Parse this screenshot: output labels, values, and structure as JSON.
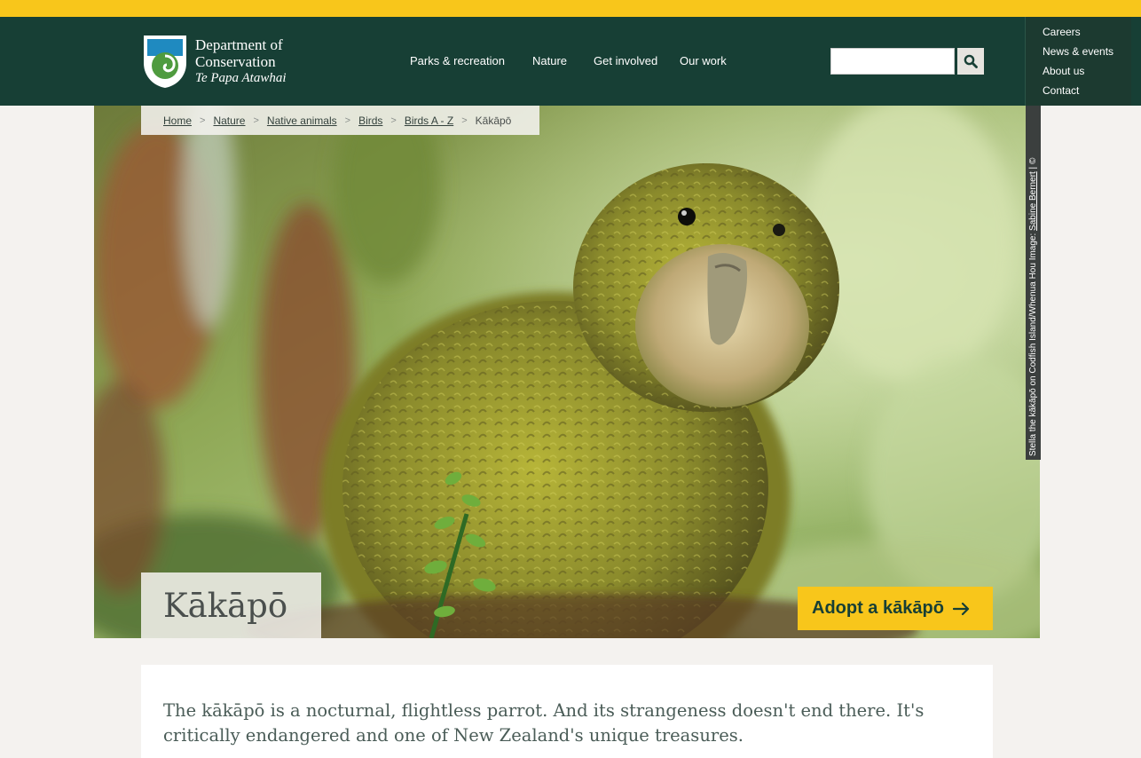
{
  "colors": {
    "brand_yellow": "#f8c61b",
    "header_green": "#173f35",
    "page_background": "#f4f2ef",
    "text_grey": "#4a4f4d"
  },
  "logo": {
    "line1": "Department of",
    "line2": "Conservation",
    "line3": "Te Papa Atawhai",
    "icon": "doc-shield-logo-icon"
  },
  "main_nav": [
    "Parks & recreation",
    "Nature",
    "Get involved",
    "Our work"
  ],
  "search": {
    "value": "",
    "icon": "search-icon"
  },
  "utility_nav": [
    "Careers",
    "News & events",
    "About us",
    "Contact"
  ],
  "breadcrumb": {
    "items": [
      "Home",
      "Nature",
      "Native animals",
      "Birds",
      "Birds A - Z"
    ],
    "current": "Kākāpō",
    "separator": ">"
  },
  "photo_credit": {
    "caption": "Stella the kākāpō on Codfish Island/Whenua Hou",
    "image_label": "Image:",
    "photographer": "Sabine Bernert",
    "separator": "|",
    "copyright": "©"
  },
  "page_title": "Kākāpō",
  "adopt_button": {
    "label": "Adopt a kākāpō",
    "icon": "arrow-right-icon"
  },
  "intro": "The kākāpō is a nocturnal, flightless parrot. And its strangeness doesn't end there. It's critically endangered and one of New Zealand's unique treasures."
}
